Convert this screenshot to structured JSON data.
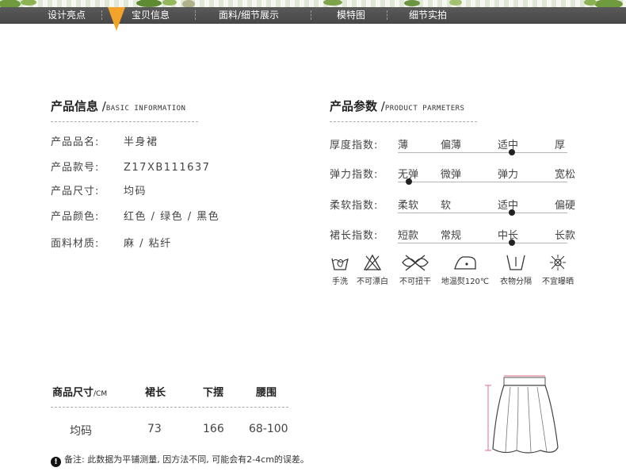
{
  "nav": {
    "items": [
      "设计亮点",
      "宝贝信息",
      "面料/细节展示",
      "模特图",
      "细节实拍"
    ],
    "active_index": 1,
    "accent_color": "#f3a32a"
  },
  "product_info": {
    "title": "产品信息",
    "subtitle": "BASIC INFORMATION",
    "rows": [
      {
        "label": "产品品名:",
        "value": "半身裙"
      },
      {
        "label": "产品款号:",
        "value": "Z17XB111637"
      },
      {
        "label": "产品尺寸:",
        "value": "均码"
      },
      {
        "label": "产品颜色:",
        "value": "红色 / 绿色 / 黑色"
      },
      {
        "label": "面料材质:",
        "value": "麻 / 粘纤"
      }
    ]
  },
  "product_params": {
    "title": "产品参数",
    "subtitle": "PRODUCT PARMETERS",
    "rows": [
      {
        "label": "厚度指数:",
        "options": [
          "薄",
          "偏薄",
          "适中",
          "厚"
        ],
        "selected": 2
      },
      {
        "label": "弹力指数:",
        "options": [
          "无弹",
          "微弹",
          "弹力",
          "宽松"
        ],
        "selected": 0
      },
      {
        "label": "柔软指数:",
        "options": [
          "柔软",
          "软",
          "适中",
          "偏硬"
        ],
        "selected": 2
      },
      {
        "label": "裙长指数:",
        "options": [
          "短款",
          "常规",
          "中长",
          "长款"
        ],
        "selected": 2
      }
    ]
  },
  "care": [
    {
      "icon": "hand-wash-icon",
      "label": "手洗"
    },
    {
      "icon": "no-bleach-icon",
      "label": "不可漂白"
    },
    {
      "icon": "no-wring-icon",
      "label": "不可扭干"
    },
    {
      "icon": "low-iron-icon",
      "label": "地温熨120℃"
    },
    {
      "icon": "separate-wash-icon",
      "label": "衣物分隔"
    },
    {
      "icon": "no-sun-dry-icon",
      "label": "不宜曝晒"
    }
  ],
  "size_table": {
    "headers": [
      "商品尺寸",
      "裙长",
      "下摆",
      "腰围"
    ],
    "unit": "/CM",
    "rows": [
      [
        "均码",
        "73",
        "166",
        "68-100"
      ]
    ]
  },
  "note": "备注: 此数据为平铺测量, 因方法不同, 可能会有2-4cm的误差。"
}
